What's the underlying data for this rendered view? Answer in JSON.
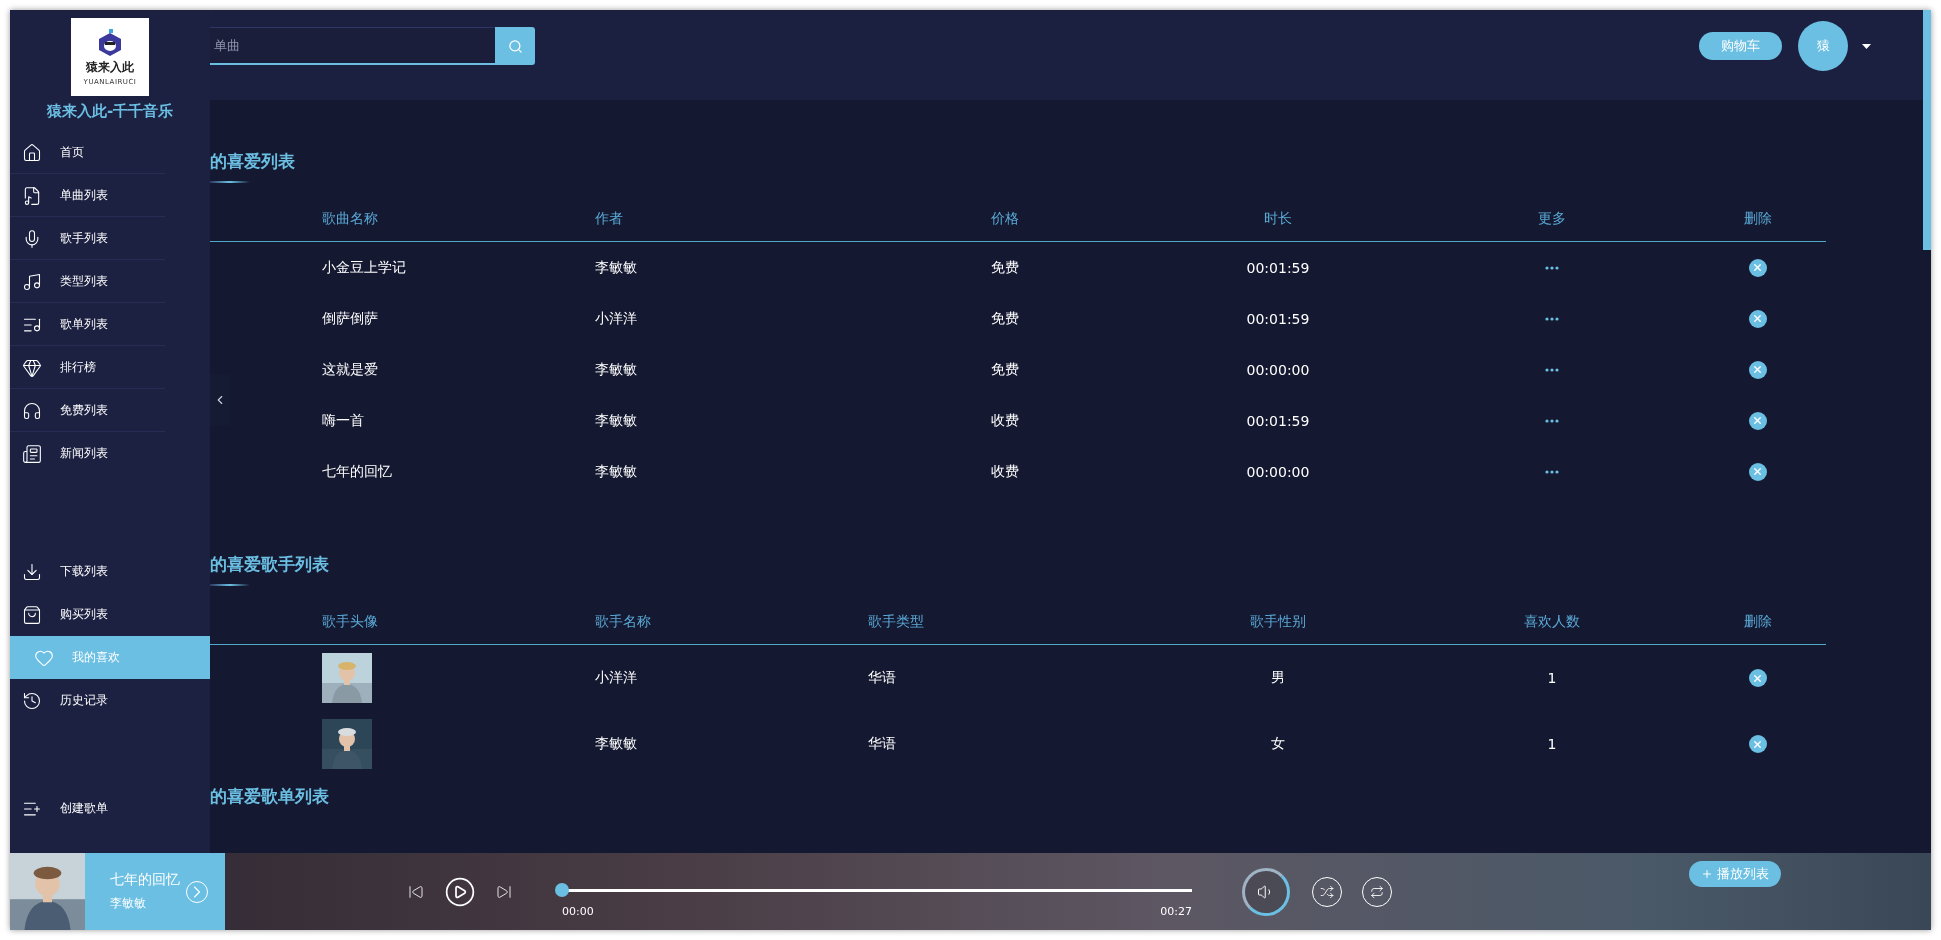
{
  "header": {
    "search": {
      "placeholder": "单曲"
    },
    "cart_button": "购物车",
    "avatar": "猿"
  },
  "sidebar": {
    "logo_text": "猿来入此",
    "logo_subtext": "YUANLAIRUCI",
    "title": "猿来入此-千千音乐",
    "sections": [
      {
        "items": [
          {
            "label": "首页",
            "selected": false
          },
          {
            "label": "单曲列表",
            "selected": false
          },
          {
            "label": "歌手列表",
            "selected": false
          },
          {
            "label": "类型列表",
            "selected": false
          },
          {
            "label": "歌单列表",
            "selected": false
          },
          {
            "label": "排行榜",
            "selected": false
          },
          {
            "label": "免费列表",
            "selected": false
          },
          {
            "label": "新闻列表",
            "selected": false
          }
        ]
      },
      {
        "items": [
          {
            "label": "下载列表",
            "selected": false
          },
          {
            "label": "购买列表",
            "selected": false
          },
          {
            "label": "我的喜欢",
            "selected": true
          },
          {
            "label": "历史记录",
            "selected": false
          }
        ]
      },
      {
        "items": [
          {
            "label": "创建歌单",
            "selected": false
          }
        ]
      }
    ]
  },
  "favorite_songs": {
    "title": "的喜爱列表",
    "columns": [
      "歌曲名称",
      "作者",
      "价格",
      "时长",
      "更多",
      "删除"
    ],
    "rows": [
      {
        "name": "小金豆上学记",
        "author": "李敏敏",
        "price": "免费",
        "duration": "00:01:59"
      },
      {
        "name": "倒萨倒萨",
        "author": "小洋洋",
        "price": "免费",
        "duration": "00:01:59"
      },
      {
        "name": "这就是爱",
        "author": "李敏敏",
        "price": "免费",
        "duration": "00:00:00"
      },
      {
        "name": "嗨一首",
        "author": "李敏敏",
        "price": "收费",
        "duration": "00:01:59"
      },
      {
        "name": "七年的回忆",
        "author": "李敏敏",
        "price": "收费",
        "duration": "00:00:00"
      }
    ]
  },
  "favorite_singers": {
    "title": "的喜爱歌手列表",
    "columns": [
      "歌手头像",
      "歌手名称",
      "歌手类型",
      "歌手性别",
      "喜欢人数",
      "删除"
    ],
    "rows": [
      {
        "name": "小洋洋",
        "type": "华语",
        "gender": "男",
        "likes": "1"
      },
      {
        "name": "李敏敏",
        "type": "华语",
        "gender": "女",
        "likes": "1"
      }
    ]
  },
  "favorite_playlists": {
    "title": "的喜爱歌单列表"
  },
  "player": {
    "song": "七年的回忆",
    "artist": "李敏敏",
    "current_time": "00:00",
    "total_time": "00:27",
    "level": 0,
    "playlist_button": "播放列表"
  }
}
